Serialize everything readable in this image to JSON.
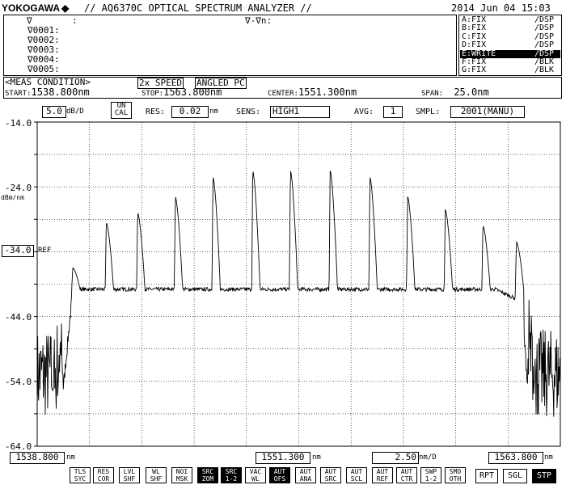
{
  "header": {
    "brand": "YOKOGAWA",
    "brand_mark": "◆",
    "title": "// AQ6370C OPTICAL SPECTRUM ANALYZER //",
    "datetime": "2014 Jun 04 15:03"
  },
  "marker_panel": {
    "heading_left": "∇",
    "heading_colon": ":",
    "heading_delta": "∇-∇n:",
    "markers": [
      "∇0001:",
      "∇0002:",
      "∇0003:",
      "∇0004:",
      "∇0005:"
    ]
  },
  "traces": [
    {
      "name": "A:FIX",
      "status": "/DSP",
      "active": false
    },
    {
      "name": "B:FIX",
      "status": "/DSP",
      "active": false
    },
    {
      "name": "C:FIX",
      "status": "/DSP",
      "active": false
    },
    {
      "name": "D:FIX",
      "status": "/DSP",
      "active": false
    },
    {
      "name": "E:WRITE",
      "status": "/DSP",
      "active": true
    },
    {
      "name": "F:FIX",
      "status": "/BLK",
      "active": false
    },
    {
      "name": "G:FIX",
      "status": "/BLK",
      "active": false
    }
  ],
  "meas": {
    "label": "<MEAS CONDITION>",
    "speed": "2x SPEED",
    "angled": "ANGLED PC",
    "start_label": "START:",
    "start": "1538.800nm",
    "stop_label": "STOP:",
    "stop": "1563.800nm",
    "center_label": "CENTER:",
    "center": "1551.300nm",
    "span_label": "SPAN:",
    "span": "25.0nm"
  },
  "settings": {
    "scale_value": "5.0",
    "scale_unit": "dB/D",
    "uncal_1": "UN",
    "uncal_2": "CAL",
    "res_label": "RES:",
    "res_value": "0.02",
    "res_unit": "nm",
    "sens_label": "SENS:",
    "sens_value": "HIGH1",
    "avg_label": "AVG:",
    "avg_value": "1",
    "smpl_label": "SMPL:",
    "smpl_value": "2001(MANU)"
  },
  "yaxis": {
    "ticks": [
      "-14.0",
      "-24.0",
      "-34.0",
      "-44.0",
      "-54.0",
      "-64.0"
    ],
    "unit": "dBm/nm",
    "ref_value": "-34.0",
    "ref_label": "REF"
  },
  "xaxis": {
    "start": "1538.800",
    "start_unit": "nm",
    "center": "1551.300",
    "center_unit": "nm",
    "div": "2.50",
    "div_unit": "nm/D",
    "stop": "1563.800",
    "stop_unit": "nm"
  },
  "softkeys": [
    {
      "l1": "TLS",
      "l2": "SYC",
      "on": false
    },
    {
      "l1": "RES",
      "l2": "COR",
      "on": false
    },
    {
      "l1": "LVL",
      "l2": "SHF",
      "on": false
    },
    {
      "l1": "WL",
      "l2": "SHF",
      "on": false
    },
    {
      "l1": "NOI",
      "l2": "MSK",
      "on": false
    },
    {
      "l1": "SRC",
      "l2": "ZOM",
      "on": true
    },
    {
      "l1": "SRC",
      "l2": "1-2",
      "on": true
    },
    {
      "l1": "VAC",
      "l2": "WL",
      "on": false
    },
    {
      "l1": "AUT",
      "l2": "OFS",
      "on": true
    },
    {
      "l1": "AUT",
      "l2": "ANA",
      "on": false
    },
    {
      "l1": "AUT",
      "l2": "SRC",
      "on": false
    },
    {
      "l1": "AUT",
      "l2": "SCL",
      "on": false
    },
    {
      "l1": "AUT",
      "l2": "REF",
      "on": false
    },
    {
      "l1": "AUT",
      "l2": "CTR",
      "on": false
    },
    {
      "l1": "SWP",
      "l2": "1-2",
      "on": false
    },
    {
      "l1": "SMO",
      "l2": "OTH",
      "on": false
    }
  ],
  "sweep_buttons": [
    {
      "label": "RPT",
      "on": false
    },
    {
      "label": "SGL",
      "on": false
    },
    {
      "label": "STP",
      "on": true
    }
  ],
  "chart_data": {
    "type": "line",
    "xlabel": "nm",
    "ylabel": "dBm/nm",
    "xlim": [
      1538.8,
      1563.8
    ],
    "ylim": [
      -64.0,
      -14.0
    ],
    "grid": true,
    "noise_floor": -39.8,
    "edge_level": -55.0,
    "plateau_start": 1540.5,
    "plateau_end": 1561.9,
    "peaks": [
      {
        "x": 1540.5,
        "y": -36.5
      },
      {
        "x": 1542.1,
        "y": -29.5
      },
      {
        "x": 1543.6,
        "y": -28.0
      },
      {
        "x": 1545.4,
        "y": -25.5
      },
      {
        "x": 1547.2,
        "y": -22.5
      },
      {
        "x": 1549.1,
        "y": -21.5
      },
      {
        "x": 1550.9,
        "y": -21.5
      },
      {
        "x": 1552.8,
        "y": -21.5
      },
      {
        "x": 1554.7,
        "y": -22.5
      },
      {
        "x": 1556.5,
        "y": -25.5
      },
      {
        "x": 1558.3,
        "y": -27.5
      },
      {
        "x": 1560.1,
        "y": -30.0
      },
      {
        "x": 1561.7,
        "y": -32.5
      }
    ]
  }
}
